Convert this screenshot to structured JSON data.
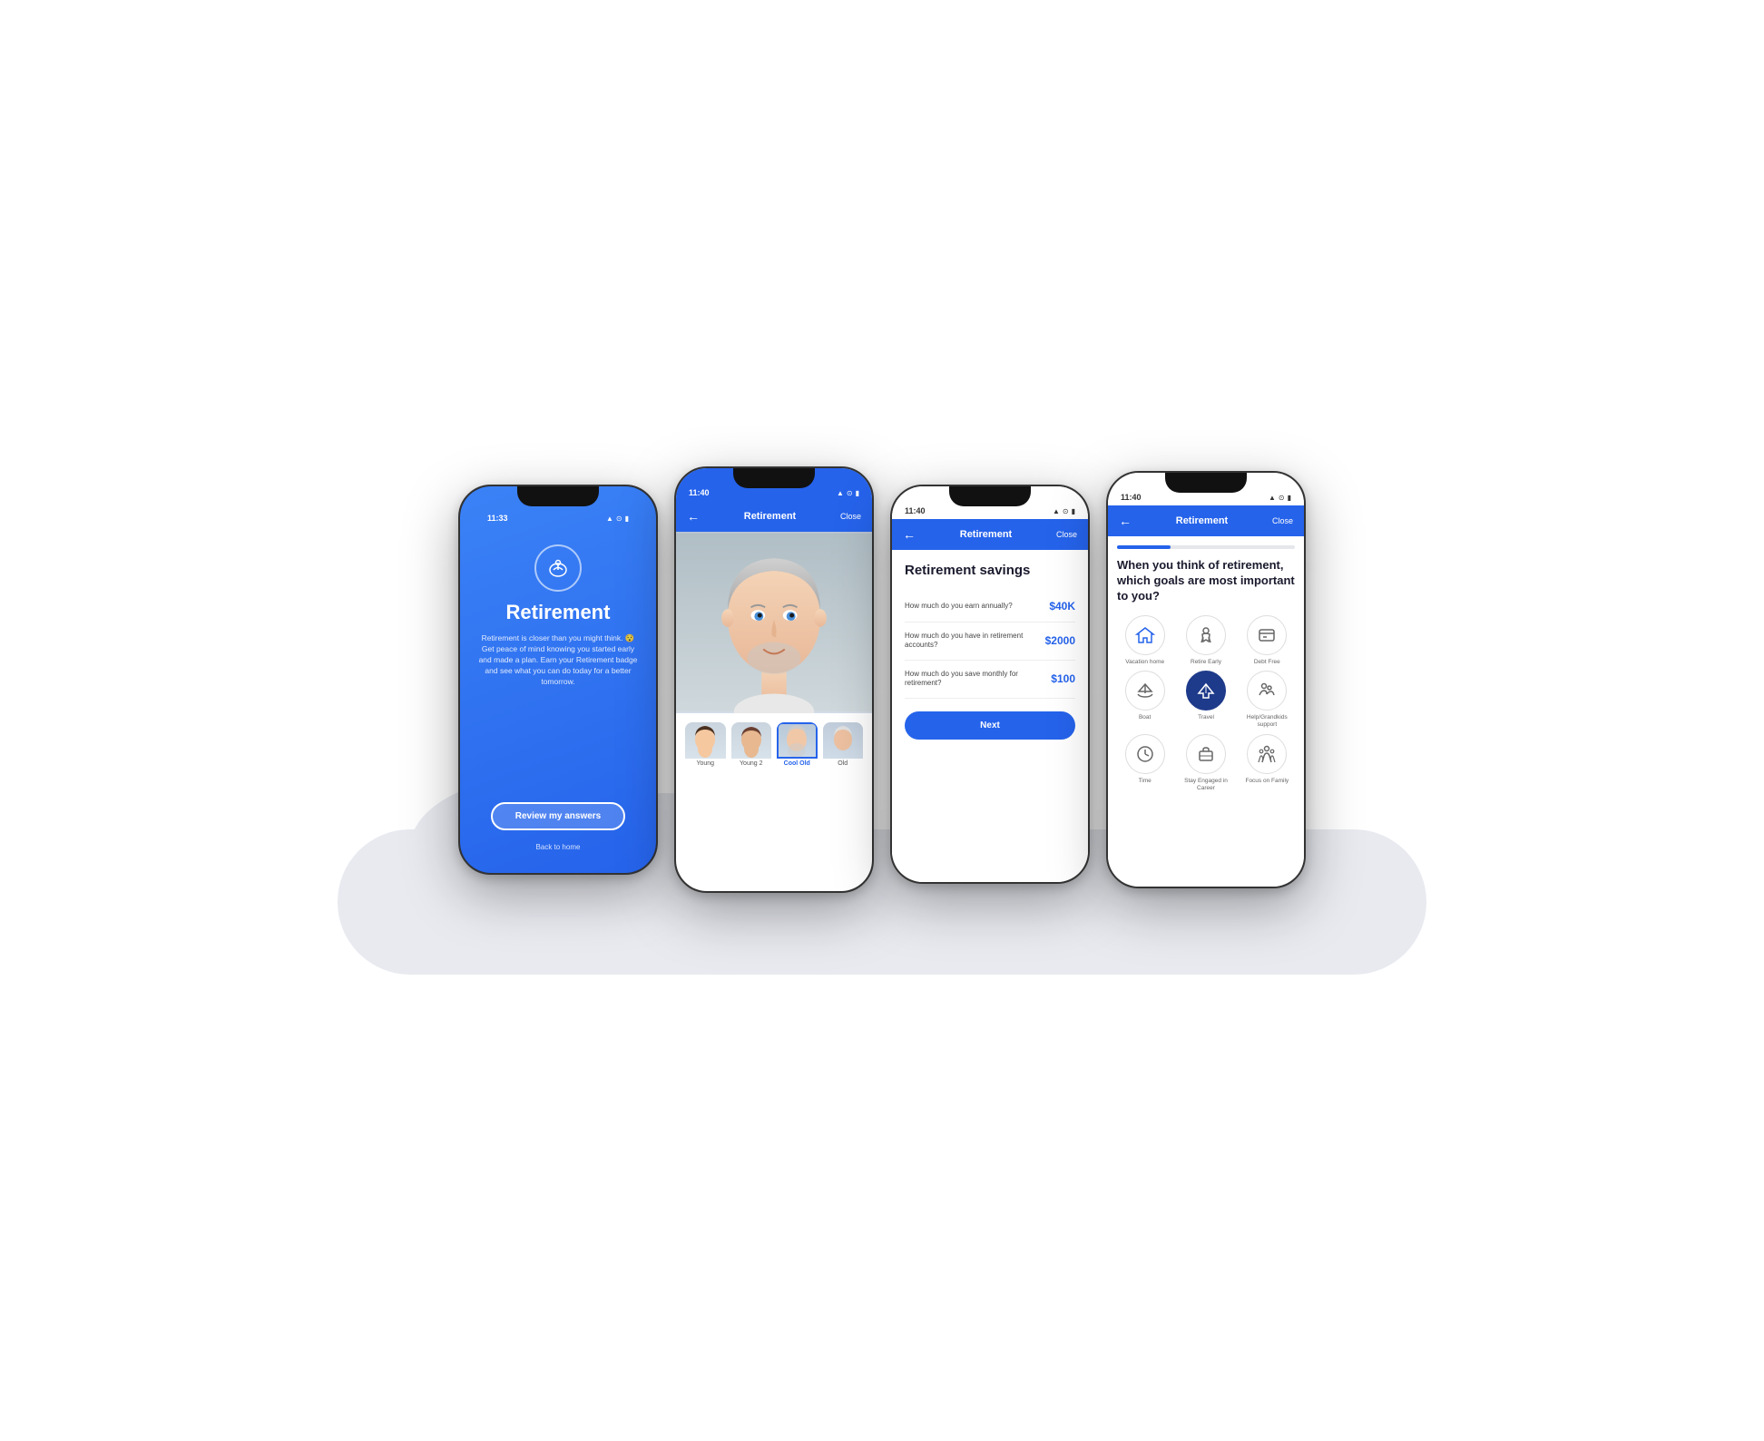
{
  "phones": {
    "phone1": {
      "status_time": "11:33",
      "title": "Retirement",
      "description": "Retirement is closer than you might think. 😯 Get peace of mind knowing you started early and made a plan. Earn your Retirement badge and see what you can do today for a better tomorrow.",
      "button_label": "Review my answers",
      "back_label": "Back to home"
    },
    "phone2": {
      "status_time": "11:40",
      "nav_title": "Retirement",
      "nav_close": "Close",
      "thumbnails": [
        {
          "label": "Young",
          "selected": false
        },
        {
          "label": "Young 2",
          "selected": false
        },
        {
          "label": "Cool Old",
          "selected": true
        },
        {
          "label": "Old",
          "selected": false
        }
      ]
    },
    "phone3": {
      "status_time": "11:40",
      "nav_title": "Retirement",
      "nav_close": "Close",
      "screen_title": "Retirement savings",
      "questions": [
        {
          "question": "How much do you earn annually?",
          "value": "$40K"
        },
        {
          "question": "How much do you have in retirement accounts?",
          "value": "$2000"
        },
        {
          "question": "How much do you save monthly for retirement?",
          "value": "$100"
        }
      ],
      "next_button": "Next"
    },
    "phone4": {
      "status_time": "11:40",
      "nav_title": "Retirement",
      "nav_close": "Close",
      "screen_title": "When you think of retirement, which goals are most important to you?",
      "progress": 30,
      "goals": [
        {
          "label": "Vacation home",
          "icon": "🏠",
          "selected": false
        },
        {
          "label": "Retire Early",
          "icon": "🏃",
          "selected": false
        },
        {
          "label": "Debt Free",
          "icon": "📊",
          "selected": false
        },
        {
          "label": "Boat",
          "icon": "⛵",
          "selected": false
        },
        {
          "label": "Travel",
          "icon": "✈️",
          "selected": true
        },
        {
          "label": "Help/Grandkids support",
          "icon": "👨‍👩‍👧",
          "selected": false
        },
        {
          "label": "Time",
          "icon": "⏰",
          "selected": false
        },
        {
          "label": "Stay Engaged in Career",
          "icon": "💼",
          "selected": false
        },
        {
          "label": "Focus on Family",
          "icon": "👨‍👩‍👧",
          "selected": false
        }
      ]
    }
  }
}
